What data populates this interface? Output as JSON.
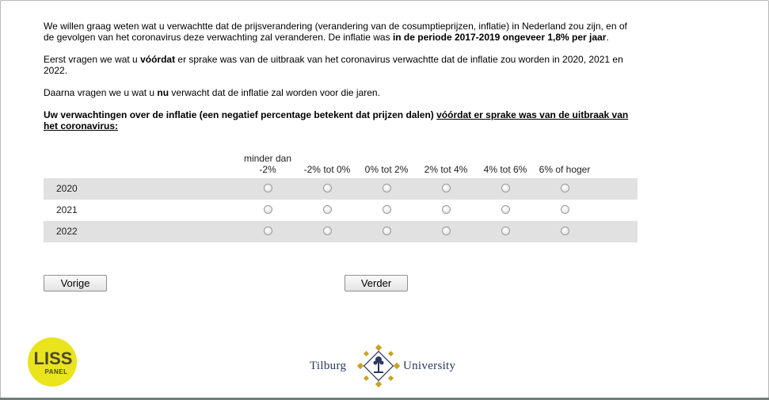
{
  "intro": {
    "p1_text": "We willen graag weten wat u verwachtte dat de prijsverandering (verandering van de cosumptieprijzen, inflatie) in Nederland zou zijn, en of de gevolgen van het coronavirus deze verwachting zal veranderen. De inflatie was ",
    "p1_bold": "in de periode 2017-2019 ongeveer 1,8% per jaar",
    "p1_end": ".",
    "p2_a": "Eerst vragen we wat u ",
    "p2_bold": "vóórdat",
    "p2_b": " er sprake was van de uitbraak van het coronavirus verwachtte dat de inflatie zou worden in 2020, 2021 en 2022.",
    "p3_a": "Daarna vragen we u wat u ",
    "p3_bold": "nu",
    "p3_b": " verwacht dat de inflatie zal worden voor die jaren."
  },
  "question": {
    "text": "Uw verwachtingen over de inflatie (een negatief percentage betekent dat prijzen dalen) ",
    "underlined": "vóórdat er sprake was van de uitbraak van het coronavirus:"
  },
  "grid": {
    "columns": [
      "minder dan -2%",
      "-2% tot 0%",
      "0% tot 2%",
      "2% tot 4%",
      "4% tot 6%",
      "6% of hoger"
    ],
    "rows": [
      "2020",
      "2021",
      "2022"
    ]
  },
  "buttons": {
    "prev_label": "Vorige",
    "next_label": "Verder"
  },
  "logos": {
    "liss_top": "LISS",
    "liss_bottom": "PANEL",
    "tilburg_left": "Tilburg",
    "tilburg_right": "University"
  },
  "colors": {
    "row_shade": "#e1e1e1",
    "liss_yellow": "#e9e41b",
    "tilburg_gold": "#c9a227",
    "tilburg_navy": "#2a3760"
  }
}
